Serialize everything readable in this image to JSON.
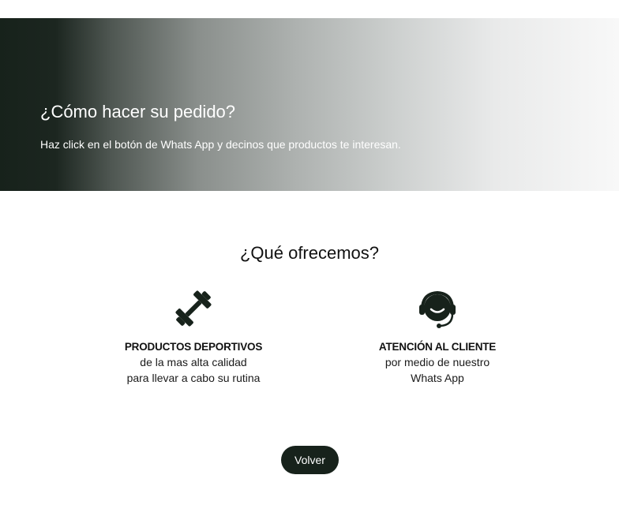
{
  "hero": {
    "title": "¿Cómo hacer su pedido?",
    "subtitle": "Haz click en el botón de Whats App y decinos que productos te interesan."
  },
  "offer": {
    "title": "¿Qué ofrecemos?",
    "features": [
      {
        "icon": "dumbbell-icon",
        "title": "PRODUCTOS DEPORTIVOS",
        "line1": "de la mas alta calidad",
        "line2": "para llevar a cabo su rutina"
      },
      {
        "icon": "headset-icon",
        "title": "ATENCIÓN AL CLIENTE",
        "line1": "por medio de nuestro",
        "line2": "Whats App"
      }
    ]
  },
  "actions": {
    "back_label": "Volver"
  },
  "colors": {
    "dark_green": "#17221b",
    "white": "#ffffff"
  }
}
